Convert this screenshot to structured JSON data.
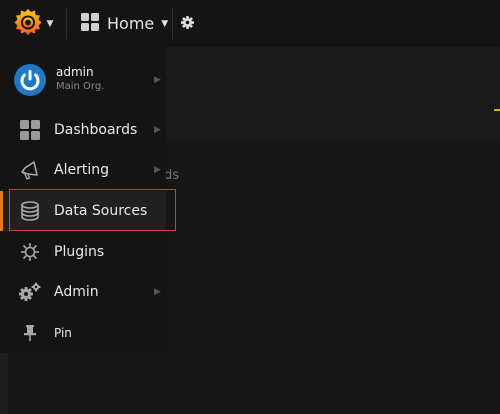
{
  "topbar": {
    "home_label": "Home",
    "logo_icon": "grafana-logo-icon",
    "settings_icon": "gear-icon"
  },
  "content": {
    "partial_text": "ds"
  },
  "sidemenu": {
    "user": {
      "name": "admin",
      "org": "Main Org."
    },
    "items": [
      {
        "label": "Dashboards",
        "icon": "dashboards-icon"
      },
      {
        "label": "Alerting",
        "icon": "alerting-icon"
      },
      {
        "label": "Data Sources",
        "icon": "database-icon"
      },
      {
        "label": "Plugins",
        "icon": "plugins-icon"
      },
      {
        "label": "Admin",
        "icon": "admin-gears-icon"
      },
      {
        "label": "Pin",
        "icon": "pin-icon"
      }
    ]
  },
  "colors": {
    "accent": "#eb7b18",
    "highlight_border": "#d43d2b",
    "avatar": "#1f78c1"
  }
}
